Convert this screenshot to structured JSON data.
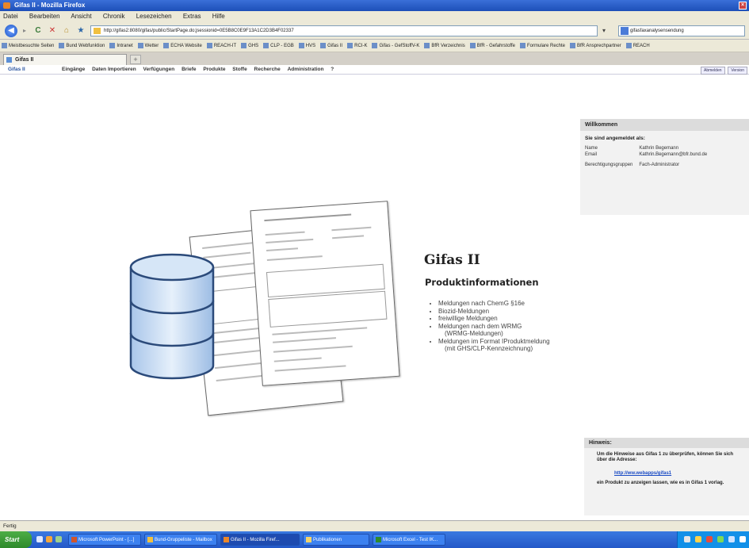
{
  "window": {
    "title": "Gifas II - Mozilla Firefox"
  },
  "menu": [
    "Datei",
    "Bearbeiten",
    "Ansicht",
    "Chronik",
    "Lesezeichen",
    "Extras",
    "Hilfe"
  ],
  "address": {
    "url": "http://gifas2:8080/gifas/public/StartPage.do;jsessionid=0E5B8C0E9F13A1C2D3B4F02337",
    "search_placeholder": "gifasfaxanalysensendung"
  },
  "bookmarks": [
    "Meistbesuchte Seiten",
    "Bund Webfunktion",
    "Intranet",
    "Wetter",
    "ECHA Website",
    "REACH-IT",
    "GHS",
    "CLP - EGB",
    "HVS",
    "Gifas II",
    "RCI-K",
    "Gifas - GefStoffV-K",
    "BfR Verzeichnis",
    "BfR - Gefahrstoffe",
    "Formulare Rechte",
    "BfR Ansprechpartner",
    "REACH"
  ],
  "tab": {
    "label": "Gifas II",
    "new_tab": "+"
  },
  "app": {
    "brand": "Gifas II",
    "nav": [
      "Eingänge",
      "Daten Importieren",
      "Verfügungen",
      "Briefe",
      "Produkte",
      "Stoffe",
      "Recherche",
      "Administration",
      "?"
    ],
    "right_buttons": [
      "Abmelden",
      "Version"
    ]
  },
  "main": {
    "title": "Gifas II",
    "subtitle": "Produktinformationen",
    "features": [
      "Meldungen nach ChemG §16e",
      "Biozid-Meldungen",
      "freiwillige Meldungen",
      "Meldungen nach dem WRMG",
      "(WRMG-Meldungen)",
      "Meldungen im Format IProduktmeldung",
      "(mit GHS/CLP-Kennzeichnung)"
    ]
  },
  "welcome": {
    "heading": "Willkommen",
    "subheading": "Sie sind angemeldet als:",
    "rows": [
      {
        "label": "Name",
        "value": "Kathrin Begemann"
      },
      {
        "label": "Email",
        "value": "Kathrin.Begemann@bfr.bund.de"
      },
      {
        "label": "Berechtigungsgruppen",
        "value": "Fach-Administrator"
      }
    ]
  },
  "hint": {
    "heading": "Hinweis:",
    "text1": "Um die Hinweise aus Gifas 1 zu überprüfen, können Sie sich über die Adresse:",
    "link": "http://ww.webapps/gifas1",
    "text2": "ein Produkt zu anzeigen lassen, wie es in Gifas 1 vorlag."
  },
  "status": {
    "text": "Fertig"
  },
  "taskbar": {
    "start": "Start",
    "tasks": [
      "Microsoft PowerPoint - [...]",
      "Bund-Gruppeliste - Mailbox",
      "Gifas II - Mozilla Firef...",
      "Publikationen",
      "Microsoft Excel - Test IK..."
    ]
  },
  "colors": {
    "accent": "#2a55a0",
    "link": "#1a4bc4",
    "db_fill": "#cfe1f5",
    "db_stroke": "#2b4a7a"
  }
}
